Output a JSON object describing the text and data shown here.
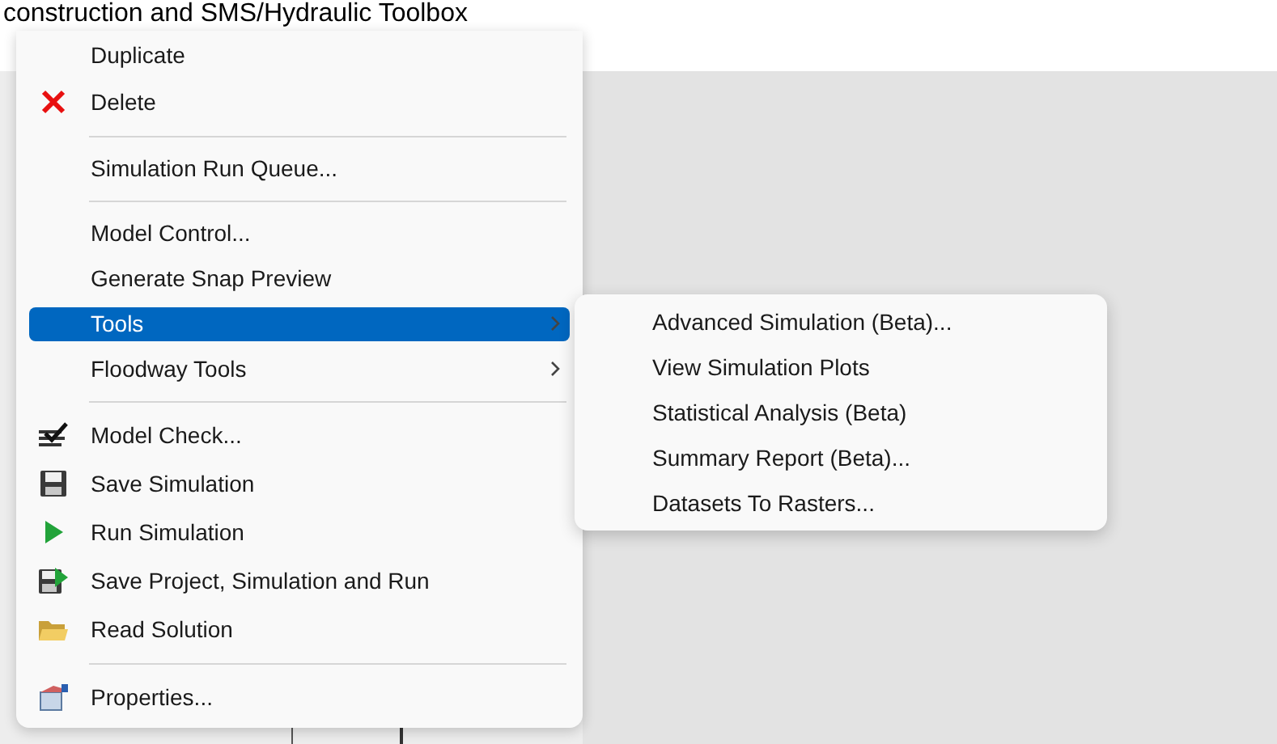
{
  "heading": "construction and SMS/Hydraulic Toolbox",
  "menu": {
    "items": [
      {
        "kind": "item",
        "label": "Duplicate",
        "selected": false
      },
      {
        "kind": "item",
        "label": "Delete",
        "selected": false
      },
      {
        "kind": "separator"
      },
      {
        "kind": "item",
        "label": "Simulation Run Queue...",
        "selected": false
      },
      {
        "kind": "separator"
      },
      {
        "kind": "item",
        "label": "Model Control...",
        "selected": false
      },
      {
        "kind": "item",
        "label": "Generate Snap Preview",
        "selected": false
      },
      {
        "kind": "submenu",
        "label": "Tools",
        "selected": true
      },
      {
        "kind": "submenu",
        "label": "Floodway Tools",
        "selected": false
      },
      {
        "kind": "separator"
      },
      {
        "kind": "item",
        "label": "Model Check...",
        "selected": false
      },
      {
        "kind": "item",
        "label": "Save Simulation",
        "selected": false
      },
      {
        "kind": "item",
        "label": "Run Simulation",
        "selected": false
      },
      {
        "kind": "item",
        "label": "Save Project, Simulation and Run",
        "selected": false
      },
      {
        "kind": "item",
        "label": "Read Solution",
        "selected": false
      },
      {
        "kind": "separator"
      },
      {
        "kind": "item",
        "label": "Properties...",
        "selected": false
      }
    ]
  },
  "submenu": {
    "items": [
      {
        "label": "Advanced Simulation (Beta)..."
      },
      {
        "label": "View Simulation Plots"
      },
      {
        "label": "Statistical Analysis (Beta)"
      },
      {
        "label": "Summary Report (Beta)..."
      },
      {
        "label": "Datasets To Rasters..."
      }
    ]
  }
}
